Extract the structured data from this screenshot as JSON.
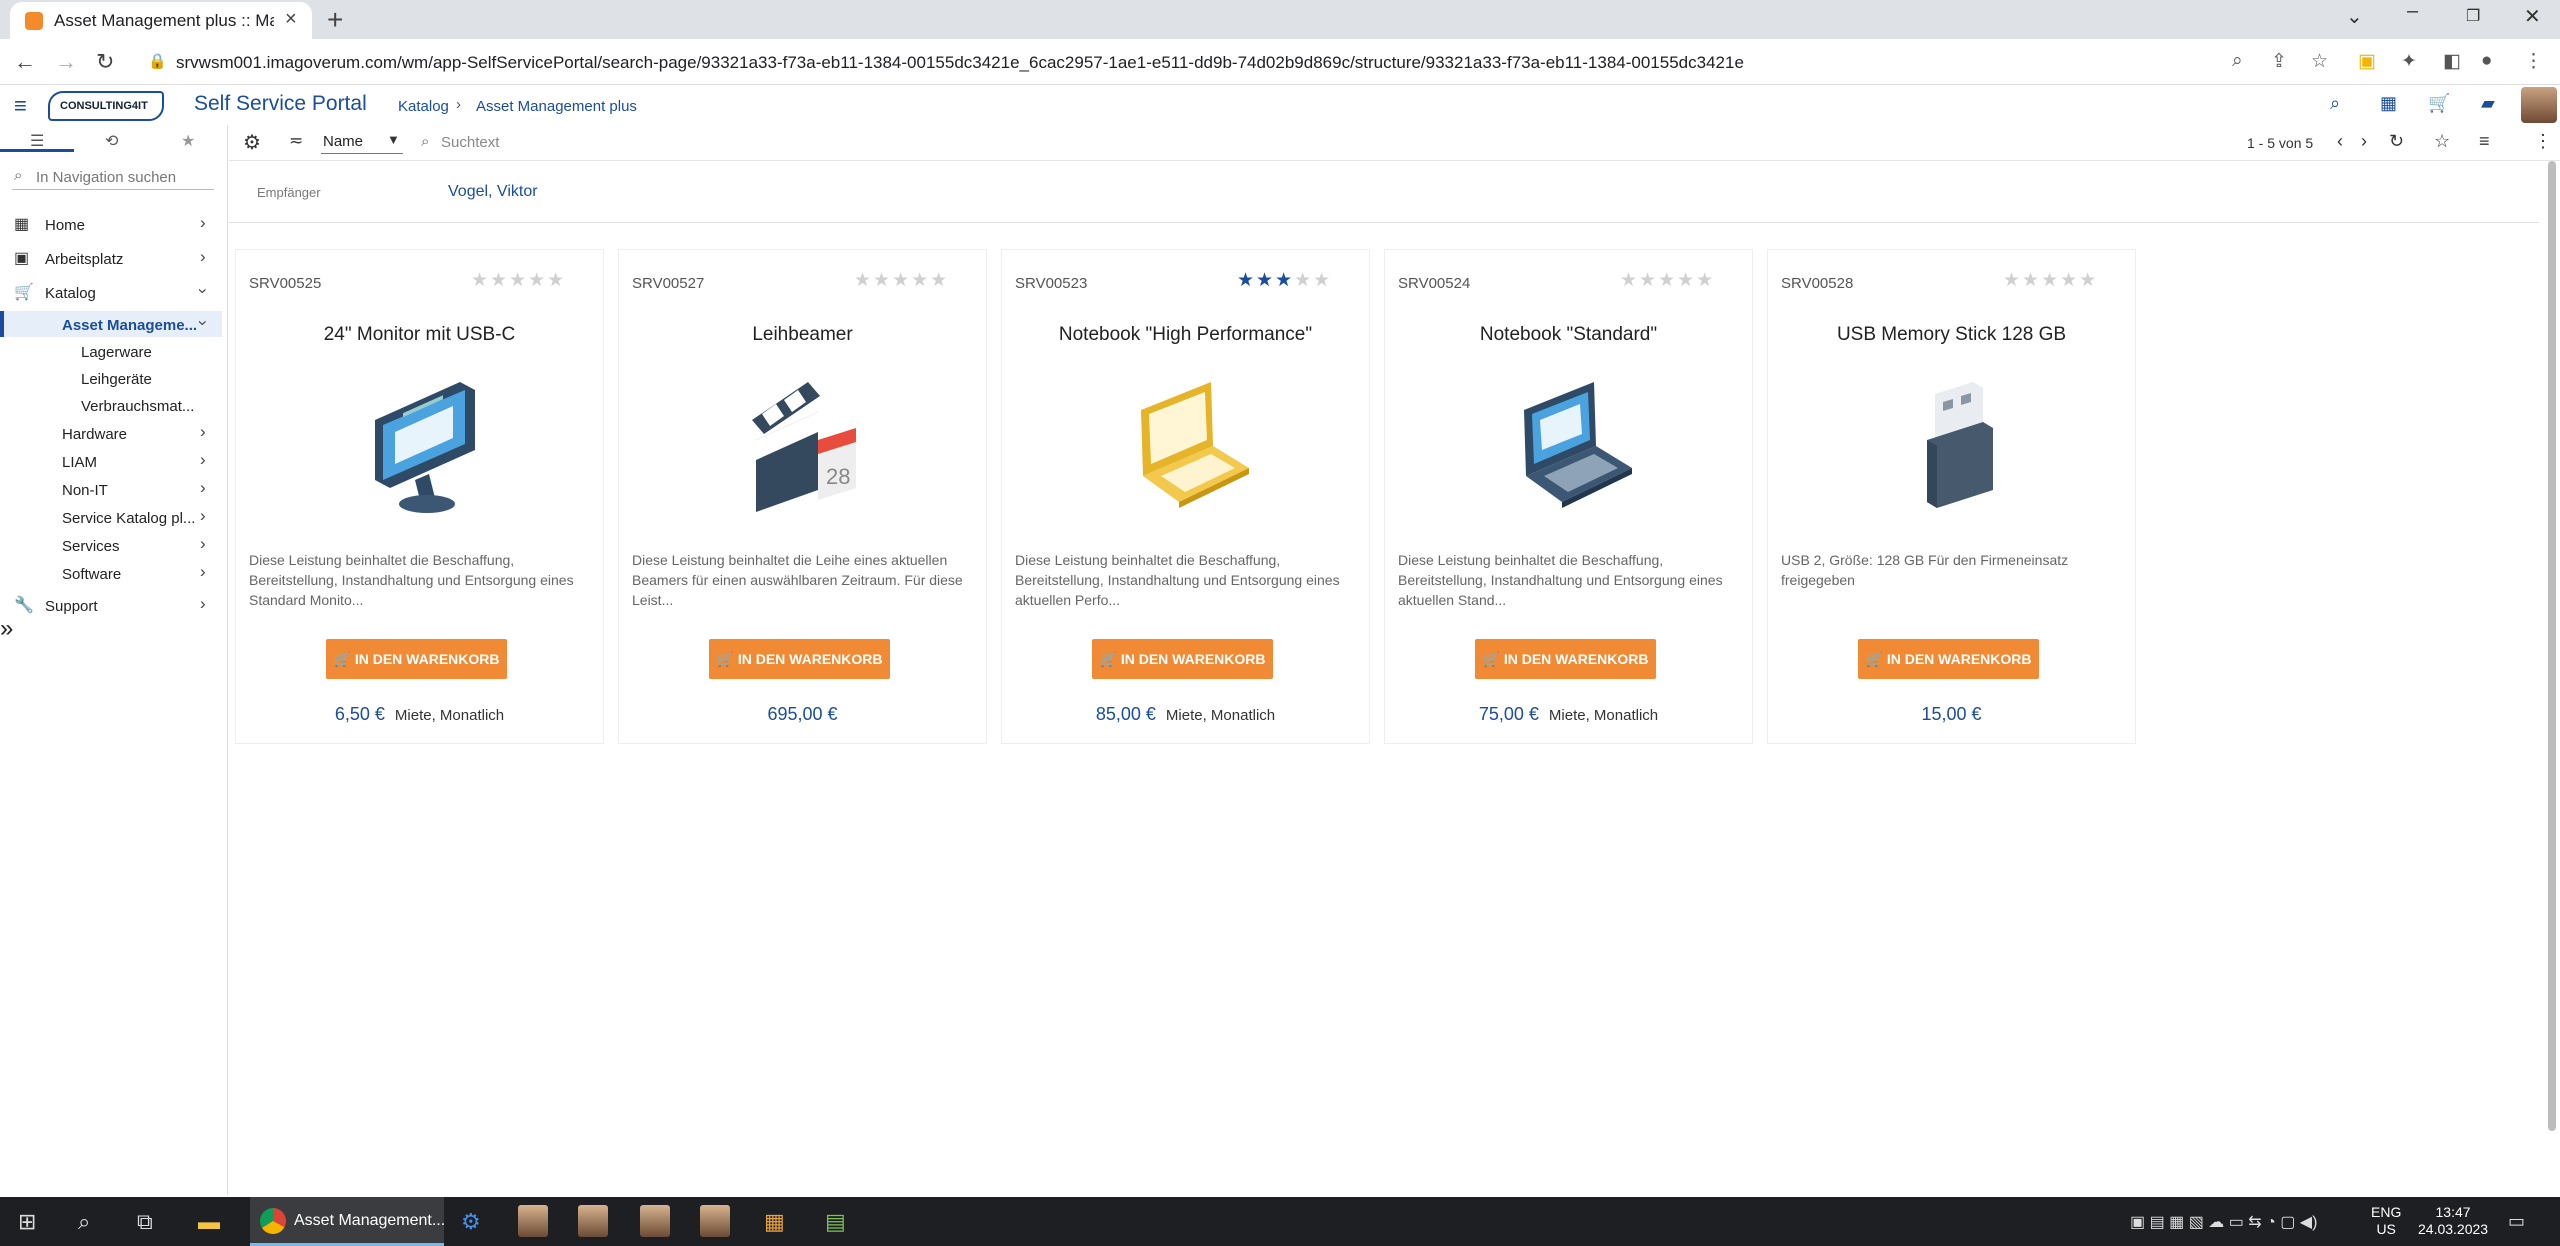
{
  "browser": {
    "tab_title": "Asset Management plus :: Matrix",
    "url": "srvwsm001.imagoverum.com/wm/app-SelfServicePortal/search-page/93321a33-f73a-eb11-1384-00155dc3421e_6cac2957-1ae1-e511-dd9b-74d02b9d869c/structure/93321a33-f73a-eb11-1384-00155dc3421e"
  },
  "header": {
    "logo": "CONSULTING4IT",
    "app_title": "Self Service Portal",
    "breadcrumb": [
      "Katalog",
      "Asset Management plus"
    ]
  },
  "sidebar": {
    "search_placeholder": "In Navigation suchen",
    "items": [
      {
        "label": "Home"
      },
      {
        "label": "Arbeitsplatz"
      },
      {
        "label": "Katalog"
      },
      {
        "label": "Asset Manageme..."
      },
      {
        "label": "Lagerware"
      },
      {
        "label": "Leihgeräte"
      },
      {
        "label": "Verbrauchsmat..."
      },
      {
        "label": "Hardware"
      },
      {
        "label": "LIAM"
      },
      {
        "label": "Non-IT"
      },
      {
        "label": "Service Katalog pl..."
      },
      {
        "label": "Services"
      },
      {
        "label": "Software"
      },
      {
        "label": "Support"
      }
    ]
  },
  "toolbar": {
    "sort_value": "Name",
    "search_placeholder": "Suchtext",
    "page_count": "1 - 5 von 5"
  },
  "recipient": {
    "label": "Empfänger",
    "value": "Vogel, Viktor"
  },
  "products": [
    {
      "code": "SRV00525",
      "name": "24\" Monitor mit USB-C",
      "rating": 0,
      "description": "Diese Leistung beinhaltet die Beschaffung, Bereitstellung, Instandhaltung und Entsorgung eines Standard Monito...",
      "button": "IN DEN WARENKORB",
      "price": "6,50 €",
      "unit": "Miete, Monatlich",
      "icon": "monitor-icon"
    },
    {
      "code": "SRV00527",
      "name": "Leihbeamer",
      "rating": 0,
      "description": "Diese Leistung beinhaltet die Leihe eines aktuellen Beamers für einen auswählbaren Zeitraum. Für diese Leist...",
      "button": "IN DEN WARENKORB",
      "price": "695,00 €",
      "unit": "",
      "icon": "clapperboard-calendar-icon"
    },
    {
      "code": "SRV00523",
      "name": "Notebook \"High Performance\"",
      "rating": 3,
      "description": "Diese Leistung beinhaltet die Beschaffung, Bereitstellung, Instandhaltung und Entsorgung eines aktuellen Perfo...",
      "button": "IN DEN WARENKORB",
      "price": "85,00 €",
      "unit": "Miete, Monatlich",
      "icon": "laptop-gold-icon"
    },
    {
      "code": "SRV00524",
      "name": "Notebook \"Standard\"",
      "rating": 0,
      "description": "Diese Leistung beinhaltet die Beschaffung, Bereitstellung, Instandhaltung und Entsorgung eines aktuellen Stand...",
      "button": "IN DEN WARENKORB",
      "price": "75,00 €",
      "unit": "Miete, Monatlich",
      "icon": "laptop-blue-icon"
    },
    {
      "code": "SRV00528",
      "name": "USB Memory Stick 128 GB",
      "rating": 0,
      "description": "USB 2, Größe: 128 GB Für den Firmeneinsatz freigegeben",
      "button": "IN DEN WARENKORB",
      "price": "15,00 €",
      "unit": "",
      "icon": "usb-stick-icon"
    }
  ],
  "taskbar": {
    "chrome_label": "Asset Management...",
    "lang": [
      "ENG",
      "US"
    ],
    "time": "13:47",
    "date": "24.03.2023"
  },
  "colors": {
    "accent": "#1a4d9c",
    "button": "#f08a34"
  }
}
